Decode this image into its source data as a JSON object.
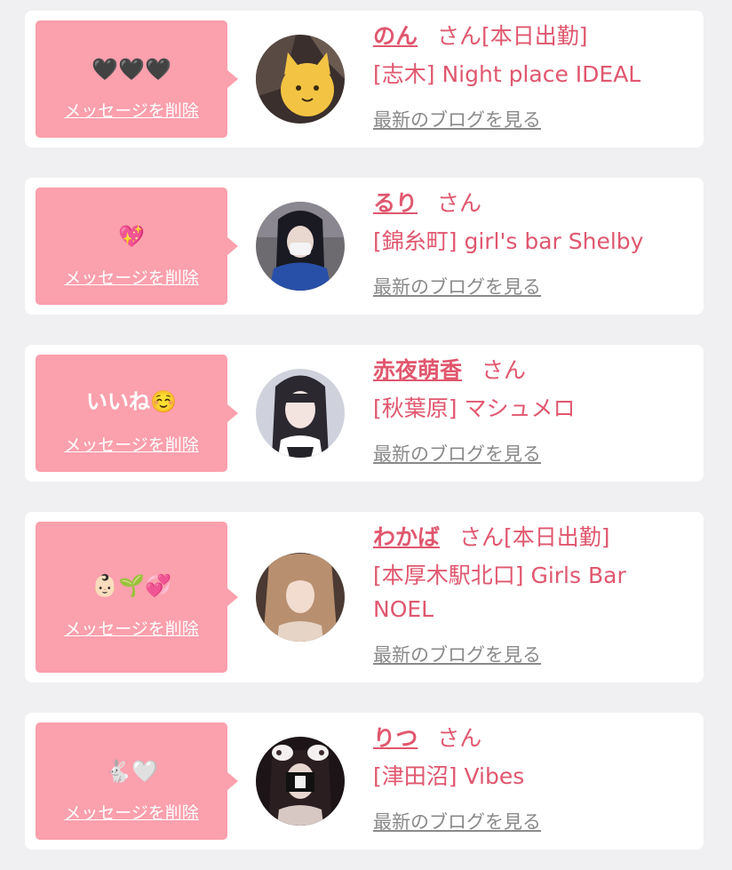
{
  "colors": {
    "accent": "#e0576e",
    "bubble": "#fba0ad",
    "link_gray": "#8a8a8a",
    "background": "#f0f0f2"
  },
  "delete_label": "メッセージを削除",
  "blog_label": "最新のブログを見る",
  "honorific": "さん",
  "messages": [
    {
      "message": "🖤🖤🖤",
      "name": "のん",
      "status": "[本日出勤]",
      "shop": "[志木] Night place IDEAL",
      "avatar_icon": "cat-face-emoji-photo"
    },
    {
      "message": "💖",
      "name": "るり",
      "status": "",
      "shop": "[錦糸町] girl's bar Shelby",
      "avatar_icon": "person-photo"
    },
    {
      "message": "いいね☺️",
      "name": "赤夜萌香",
      "status": "",
      "shop": "[秋葉原] マシュメロ",
      "avatar_icon": "person-photo"
    },
    {
      "message": "👶🏻🌱💞",
      "name": "わかば",
      "status": "[本日出勤]",
      "shop": "[本厚木駅北口] Girls Bar NOEL",
      "avatar_icon": "person-photo"
    },
    {
      "message": "🐇🤍",
      "name": "りつ",
      "status": "",
      "shop": "[津田沼] Vibes",
      "avatar_icon": "person-photo"
    }
  ]
}
